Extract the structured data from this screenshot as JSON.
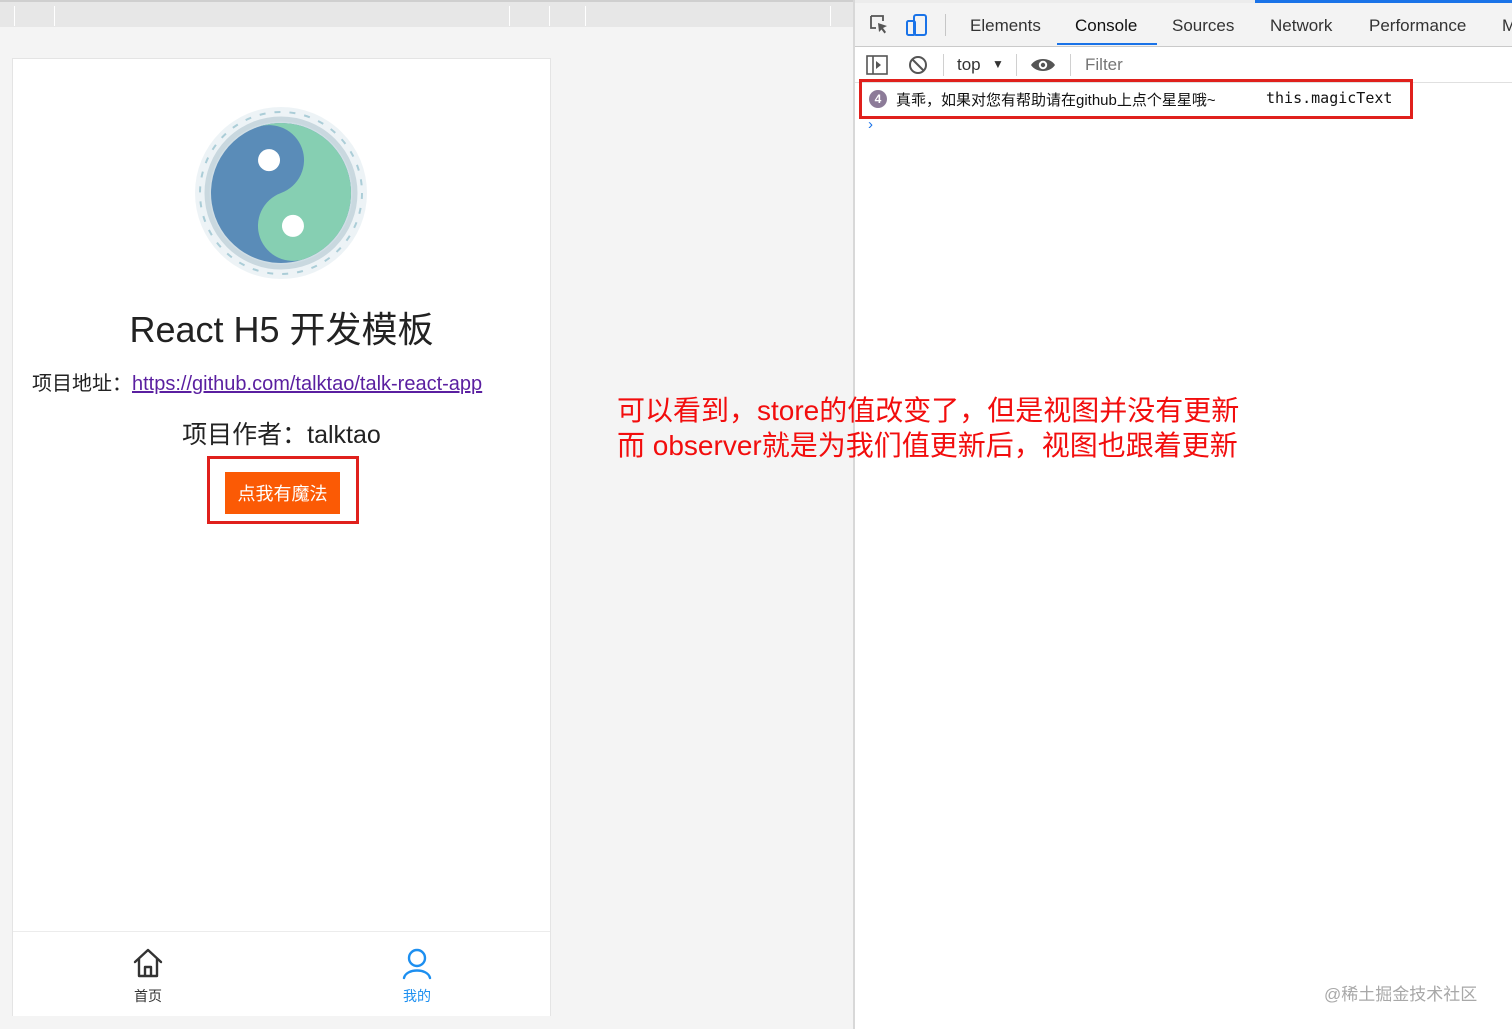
{
  "phone": {
    "title": "React H5 开发模板",
    "address_label": "项目地址：",
    "address_link": "https://github.com/talktao/talk-react-app",
    "author": "项目作者：talktao",
    "magic_button": "点我有魔法",
    "tabbar": [
      {
        "label": "首页",
        "icon": "home-icon",
        "active": false
      },
      {
        "label": "我的",
        "icon": "user-icon",
        "active": true
      }
    ]
  },
  "annotation": {
    "line1": "可以看到，store的值改变了，但是视图并没有更新",
    "line2": "而 observer就是为我们值更新后，视图也跟着更新"
  },
  "devtools": {
    "tabs": [
      "Elements",
      "Console",
      "Sources",
      "Network",
      "Performance",
      "M"
    ],
    "active_tab": "Console",
    "context": "top",
    "filter_placeholder": "Filter",
    "log": {
      "count": "4",
      "message": "真乖，如果对您有帮助请在github上点个星星哦~",
      "source": "this.magicText"
    },
    "prompt": "›"
  },
  "watermark": "@稀土掘金技术社区",
  "colors": {
    "annotation": "#f20d0d",
    "highlight_border": "#e0201c",
    "magic_button_bg": "#fb5a05",
    "link": "#5a1fa0",
    "active_tab": "#1d8ff0",
    "devtools_accent": "#1a73e8"
  }
}
